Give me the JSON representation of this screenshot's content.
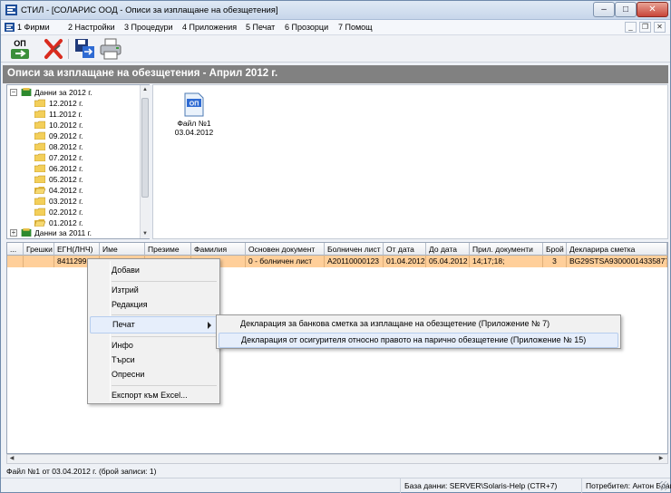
{
  "window": {
    "title": "СТИЛ - [СОЛАРИС ООД - Описи за изплащане на обезщетения]"
  },
  "menu": [
    "1 Фирми",
    "2 Настройки",
    "3 Процедури",
    "4 Приложения",
    "5 Печат",
    "6 Прозорци",
    "7 Помощ"
  ],
  "toolbar": {
    "op_icon_text": "ОП"
  },
  "header": {
    "title": "Описи за изплащане на обезщетения - Април 2012 г."
  },
  "tree": {
    "root": "Данни за 2012 г.",
    "months": [
      "12.2012 г.",
      "11.2012 г.",
      "10.2012 г.",
      "09.2012 г.",
      "08.2012 г.",
      "07.2012 г.",
      "06.2012 г.",
      "05.2012 г.",
      "04.2012 г.",
      "03.2012 г.",
      "02.2012 г.",
      "01.2012 г."
    ],
    "prev": "Данни за 2011 г."
  },
  "file": {
    "icon_text": "ОП",
    "name": "Файл №1",
    "date": "03.04.2012"
  },
  "grid": {
    "headers": [
      "...",
      "Грешки",
      "ЕГН(ЛНЧ)",
      "Име",
      "Презиме",
      "Фамилия",
      "Основен документ",
      "Болничен лист",
      "От дата",
      "До дата",
      "Прил. документи",
      "Брой",
      "Декларира сметка"
    ],
    "row": [
      "",
      "",
      "84112992",
      "И",
      "",
      "рова",
      "0 - болничен лист",
      "А20110000123",
      "01.04.2012",
      "05.04.2012",
      "14;17;18;",
      "3",
      "BG29STSA93000014335877"
    ]
  },
  "context_menu": {
    "items": [
      "Добави",
      "Изтрий",
      "Редакция",
      "Печат",
      "Инфо",
      "Търси",
      "Опресни",
      "Експорт към Excel..."
    ]
  },
  "submenu": {
    "items": [
      "Декларация за банкова сметка за изплащане на обезщетение (Приложение № 7)",
      "Декларация от осигурителя относно правото на парично обезщетение (Приложение № 15)"
    ]
  },
  "status": {
    "records": "Файл №1 от 03.04.2012 г. (брой записи: 1)",
    "database": "База данни: SERVER\\Solaris-Help (CTR+7)",
    "user": "Потребител: Антон Благоев"
  }
}
